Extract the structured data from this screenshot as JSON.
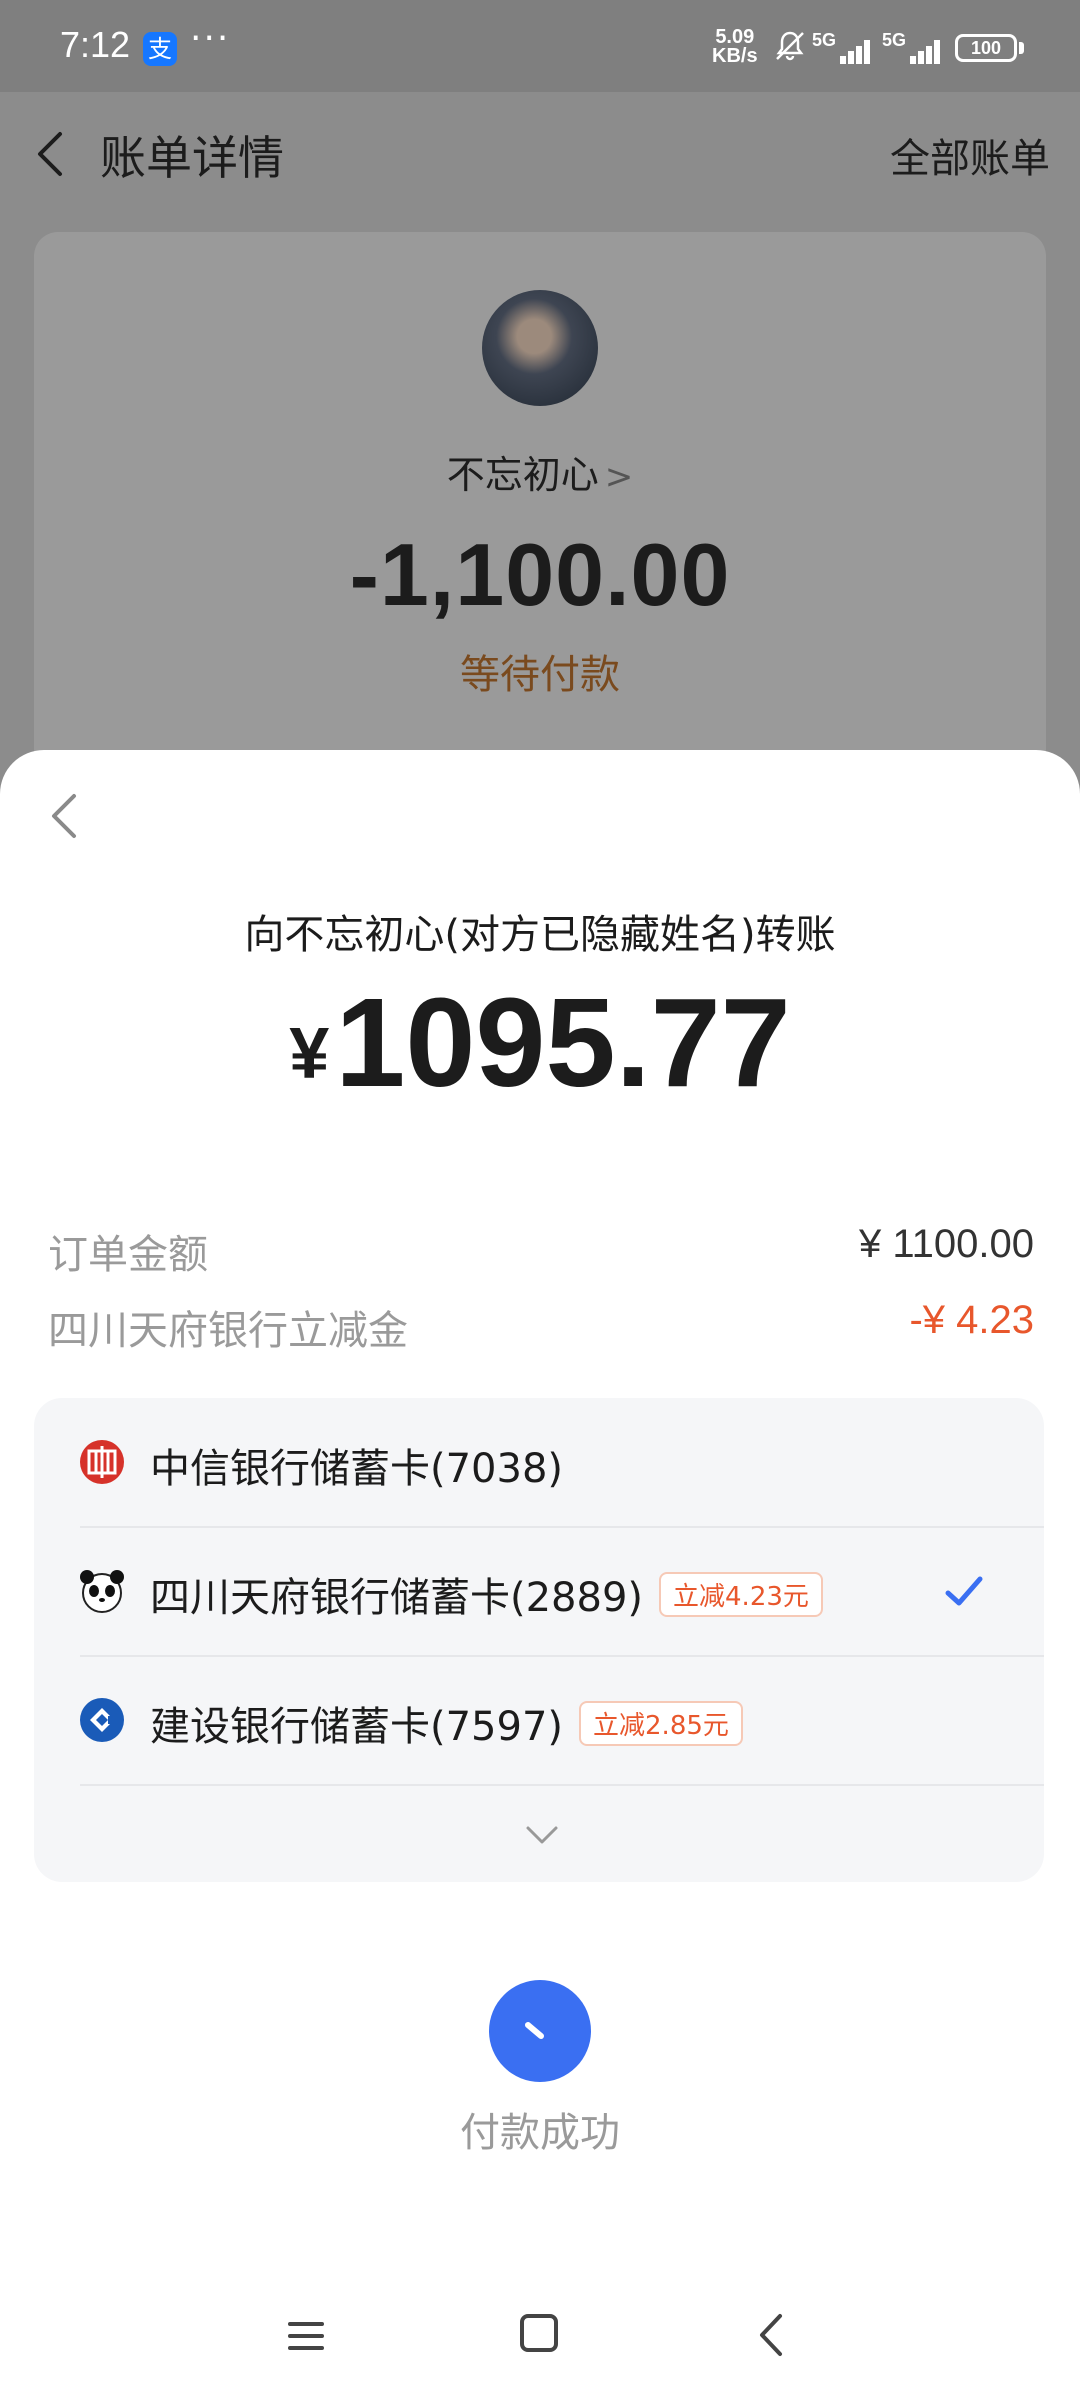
{
  "status_bar": {
    "time": "7:12",
    "app_badge": "支",
    "more": "···",
    "speed_value": "5.09",
    "speed_unit": "KB/s",
    "net1": "5G",
    "net2": "5G",
    "battery": "100"
  },
  "header": {
    "title": "账单详情",
    "all_bills": "全部账单"
  },
  "bill": {
    "payee": "不忘初心",
    "amount": "-1,100.00",
    "status": "等待付款"
  },
  "sheet": {
    "title": "向不忘初心(对方已隐藏姓名)转账",
    "currency": "¥",
    "amount": "1095.77",
    "order_label": "订单金额",
    "order_value": "¥ 1100.00",
    "discount_label": "四川天府银行立减金",
    "discount_value": "-¥ 4.23",
    "banks": [
      {
        "name": "中信银行储蓄卡(7038)",
        "tag": "",
        "icon": "citic-bank-icon",
        "selected": false
      },
      {
        "name": "四川天府银行储蓄卡(2889)",
        "tag": "立减4.23元",
        "icon": "panda-bank-icon",
        "selected": true
      },
      {
        "name": "建设银行储蓄卡(7597)",
        "tag": "立减2.85元",
        "icon": "ccb-bank-icon",
        "selected": false
      }
    ],
    "pay_status": "付款成功"
  },
  "colors": {
    "accent": "#3a6ff2",
    "discount": "#e8572c",
    "pending": "#7a4a1e"
  }
}
